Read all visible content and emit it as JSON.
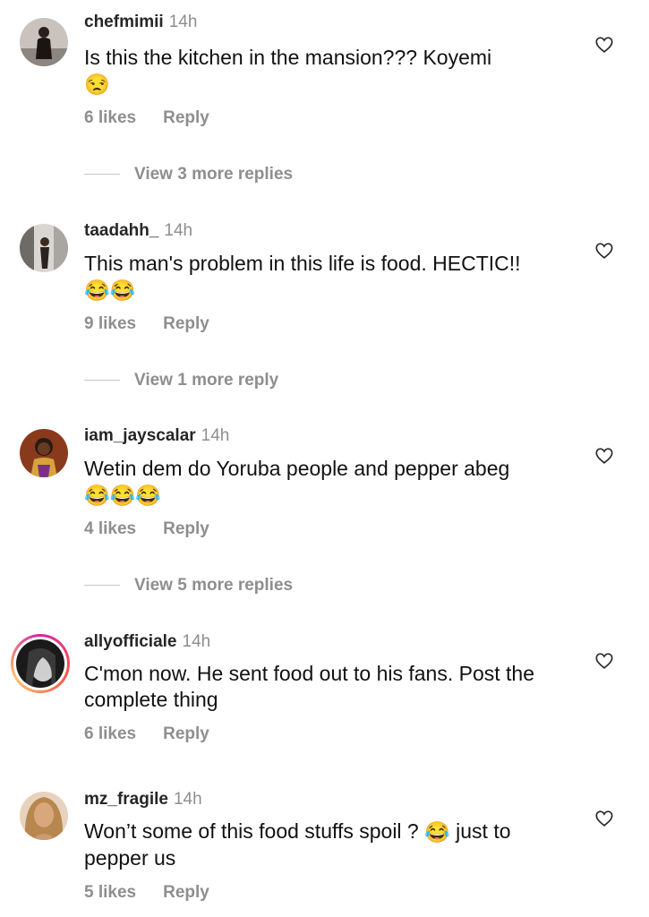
{
  "comments": [
    {
      "user": "chefmimii",
      "time": "14h",
      "text": "Is this the kitchen in the mansion??? Koyemi",
      "emojis": "😒",
      "likes": "6 likes",
      "reply": "Reply",
      "more": "View 3 more replies"
    },
    {
      "user": "taadahh_",
      "time": "14h",
      "text": "This man's problem in this life is food. HECTIC!!",
      "emojis": "😂😂",
      "likes": "9 likes",
      "reply": "Reply",
      "more": "View 1 more reply"
    },
    {
      "user": "iam_jayscalar",
      "time": "14h",
      "text": "Wetin dem do Yoruba people and pepper abeg",
      "emojis": "😂😂😂",
      "likes": "4 likes",
      "reply": "Reply",
      "more": "View 5 more replies"
    },
    {
      "user": "allyofficiale",
      "time": "14h",
      "text": "C'mon now. He sent food out to his fans. Post the complete thing",
      "likes": "6 likes",
      "reply": "Reply"
    },
    {
      "user": "mz_fragile",
      "time": "14h",
      "text_before": "Won’t some of this food stuffs spoil ?",
      "emoji_mid": "😂",
      "text_after": "just to pepper us",
      "likes": "5 likes",
      "reply": "Reply"
    }
  ],
  "colors": {
    "muted": "#8e8e8e",
    "username": "#262626",
    "story_ring": "#d6249f"
  },
  "icons": {
    "like": "heart-outline-icon"
  }
}
